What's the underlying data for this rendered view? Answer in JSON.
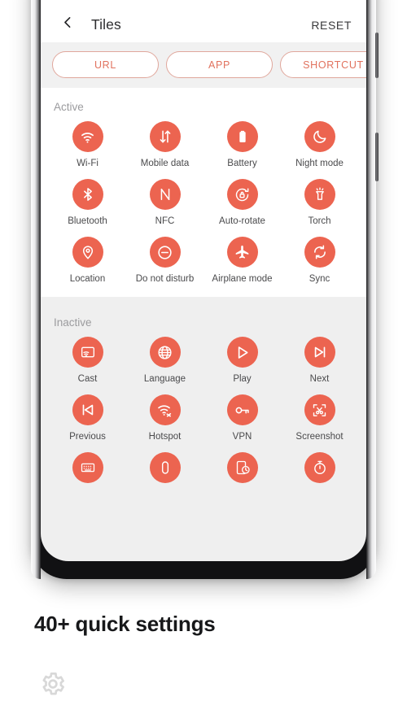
{
  "app": {
    "header": {
      "back_icon": "chevron-left-icon",
      "title": "Tiles",
      "reset_label": "RESET"
    },
    "segments": [
      {
        "label": "URL",
        "icon": "link-icon"
      },
      {
        "label": "APP",
        "icon": "app-icon"
      },
      {
        "label": "SHORTCUT",
        "icon": "shortcut-icon"
      }
    ],
    "sections": [
      {
        "label": "Active",
        "tiles": [
          {
            "label": "Wi-Fi",
            "icon": "wifi-icon"
          },
          {
            "label": "Mobile data",
            "icon": "mobile-data-icon"
          },
          {
            "label": "Battery",
            "icon": "battery-icon"
          },
          {
            "label": "Night mode",
            "icon": "moon-icon"
          },
          {
            "label": "Bluetooth",
            "icon": "bluetooth-icon"
          },
          {
            "label": "NFC",
            "icon": "nfc-icon"
          },
          {
            "label": "Auto-rotate",
            "icon": "auto-rotate-icon"
          },
          {
            "label": "Torch",
            "icon": "torch-icon"
          },
          {
            "label": "Location",
            "icon": "location-pin-icon"
          },
          {
            "label": "Do not disturb",
            "icon": "do-not-disturb-icon"
          },
          {
            "label": "Airplane mode",
            "icon": "airplane-icon"
          },
          {
            "label": "Sync",
            "icon": "sync-icon"
          }
        ]
      },
      {
        "label": "Inactive",
        "tiles": [
          {
            "label": "Previous",
            "icon": "skip-previous-icon"
          },
          {
            "label": "Hotspot",
            "icon": "hotspot-icon"
          },
          {
            "label": "VPN",
            "icon": "key-icon"
          },
          {
            "label": "Screenshot",
            "icon": "screenshot-icon"
          },
          {
            "label": "Cast",
            "icon": "cast-icon"
          },
          {
            "label": "Language",
            "icon": "globe-icon"
          },
          {
            "label": "Play",
            "icon": "play-icon"
          },
          {
            "label": "Next",
            "icon": "skip-next-icon"
          },
          {
            "label": "",
            "icon": "keyboard-icon"
          },
          {
            "label": "",
            "icon": "capsule-icon"
          },
          {
            "label": "",
            "icon": "screen-timeout-icon"
          },
          {
            "label": "",
            "icon": "stopwatch-icon"
          }
        ]
      }
    ]
  },
  "caption": {
    "headline": "40+ quick settings",
    "gear_icon": "gear-icon"
  },
  "colors": {
    "accent": "#ec6450",
    "pill_border": "#e0a79c",
    "pill_text": "#e1725e",
    "screen_bg": "#efefef",
    "card_bg": "#ffffff",
    "section_label": "#9b9b9e",
    "tile_label": "#4a4a4c",
    "device_body": "#111113",
    "caption_text": "#17181a",
    "gear_gray": "#d8d8d8"
  }
}
